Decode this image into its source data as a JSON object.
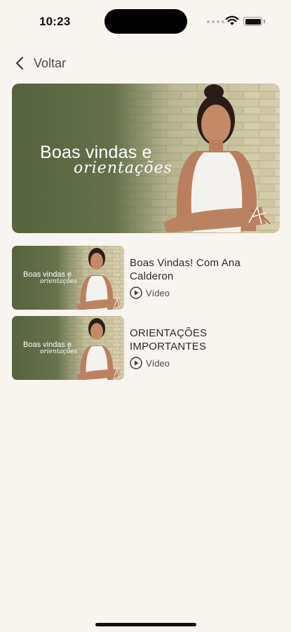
{
  "status_bar": {
    "time": "10:23"
  },
  "nav": {
    "back_label": "Voltar"
  },
  "hero": {
    "title_line1": "Boas vindas e",
    "title_line2": "orientações"
  },
  "videos": [
    {
      "title": "Boas Vindas! Com Ana Calderon",
      "type_label": "Vídeo",
      "thumb_line1": "Boas vindas e",
      "thumb_line2": "orientações"
    },
    {
      "title": "ORIENTAÇÕES IMPORTANTES",
      "type_label": "Vídeo",
      "thumb_line1": "Boas vindas e",
      "thumb_line2": "orientações"
    }
  ],
  "colors": {
    "background": "#f8f5f0",
    "banner_green": "#5e6b45",
    "brick": "#b9ad88"
  },
  "icons": [
    "back-chevron-icon",
    "play-circle-icon",
    "wifi-icon",
    "battery-icon"
  ]
}
